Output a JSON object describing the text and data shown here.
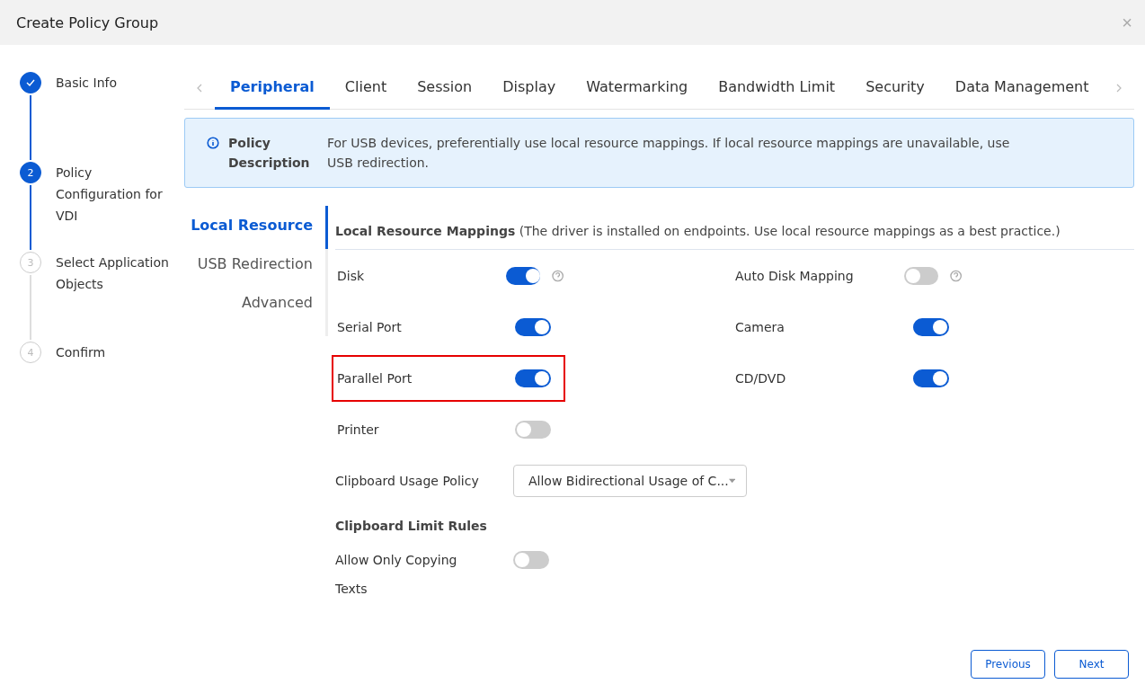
{
  "dialog": {
    "title": "Create Policy Group",
    "close": "×"
  },
  "steps": [
    {
      "label": "Basic Info",
      "done": true,
      "current": false
    },
    {
      "number": "2",
      "label": "Policy Configuration for VDI",
      "done": false,
      "current": true
    },
    {
      "number": "3",
      "label": "Select Application Objects",
      "done": false,
      "current": false
    },
    {
      "number": "4",
      "label": "Confirm",
      "done": false,
      "current": false
    }
  ],
  "tabs": [
    {
      "label": "Peripheral",
      "selected": true
    },
    {
      "label": "Client",
      "selected": false
    },
    {
      "label": "Session",
      "selected": false
    },
    {
      "label": "Display",
      "selected": false
    },
    {
      "label": "Watermarking",
      "selected": false
    },
    {
      "label": "Bandwidth Limit",
      "selected": false
    },
    {
      "label": "Security",
      "selected": false
    },
    {
      "label": "Data Management",
      "selected": false
    }
  ],
  "policy_description": {
    "label": "Policy Description",
    "text": "For USB devices, preferentially use local resource mappings. If local resource mappings are unavailable, use USB redirection."
  },
  "sub_nav": [
    {
      "label": "Local Resource",
      "selected": true
    },
    {
      "label": "USB Redirection",
      "selected": false
    },
    {
      "label": "Advanced",
      "selected": false
    }
  ],
  "section": {
    "title": "**Local Resource Mappings** (The driver is installed on endpoints. Use local resource mappings as a best practice.)"
  },
  "mappings": [
    [
      {
        "label": "Disk",
        "on": true,
        "help": true,
        "highlighted": false
      },
      {
        "label": "Auto Disk Mapping",
        "on": false,
        "help": true,
        "highlighted": false
      }
    ],
    [
      {
        "label": "Serial Port",
        "on": true,
        "help": false,
        "highlighted": false
      },
      {
        "label": "Camera",
        "on": true,
        "help": false,
        "highlighted": false
      }
    ],
    [
      {
        "label": "Parallel Port",
        "on": true,
        "help": false,
        "highlighted": true
      },
      {
        "label": "CD/DVD",
        "on": true,
        "help": false,
        "highlighted": false
      }
    ],
    [
      {
        "label": "Printer",
        "on": false,
        "help": false,
        "highlighted": false
      }
    ]
  ],
  "clipboard_usage": {
    "label": "Clipboard Usage Policy",
    "value": "Allow Bidirectional Usage of C..."
  },
  "clipboard_limit": {
    "title": "Clipboard Limit Rules",
    "label": "Allow Only Copying Texts",
    "on": false
  },
  "buttons": [
    {
      "label": "Previous"
    },
    {
      "label": "Next"
    }
  ]
}
